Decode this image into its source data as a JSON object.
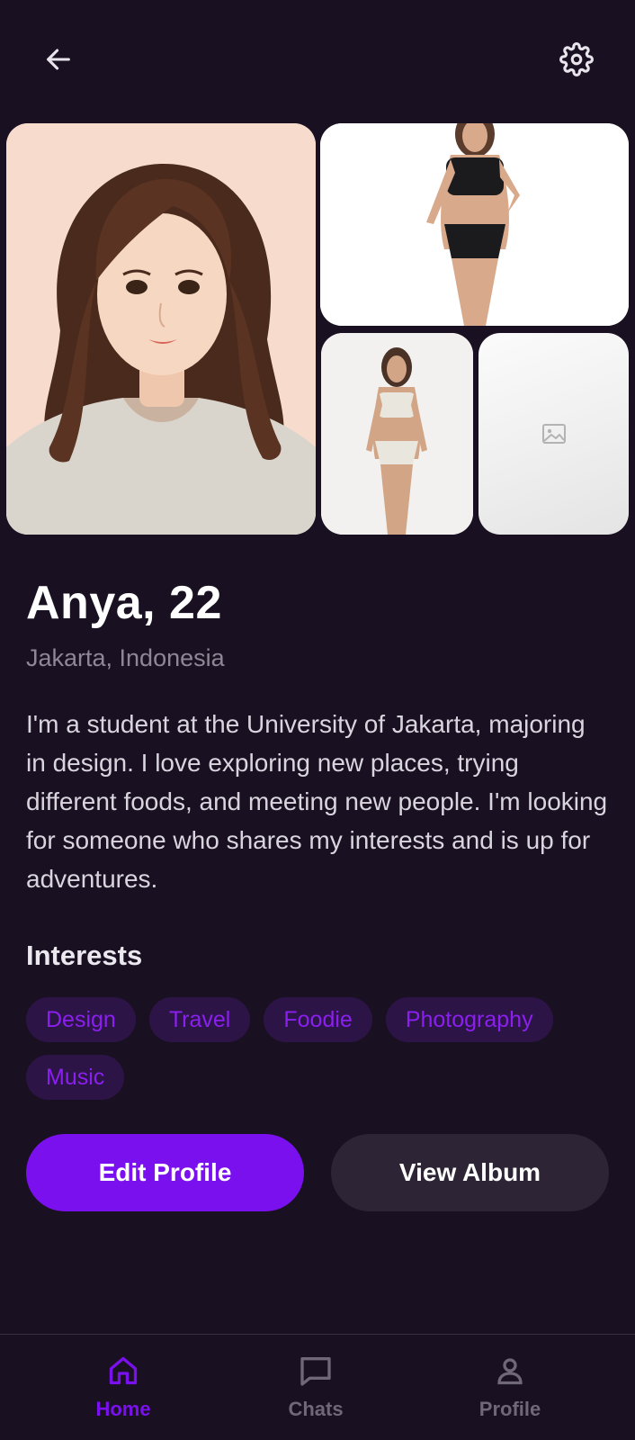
{
  "header": {
    "back_icon": "arrow-left-icon",
    "settings_icon": "gear-icon"
  },
  "photos": {
    "main": "portrait-illustration",
    "top_right": "photo",
    "small": "photo",
    "empty_icon": "image-placeholder-icon"
  },
  "profile": {
    "name_age": "Anya, 22",
    "location": "Jakarta, Indonesia",
    "bio": "I'm a student at the University of Jakarta, majoring in design. I love exploring new places, trying different foods, and meeting new people. I'm looking for someone who shares my interests and is up for adventures."
  },
  "interests": {
    "title": "Interests",
    "chips": [
      "Design",
      "Travel",
      "Foodie",
      "Photography",
      "Music"
    ]
  },
  "actions": {
    "edit_label": "Edit Profile",
    "album_label": "View Album"
  },
  "nav": {
    "items": [
      {
        "label": "Home",
        "icon": "home-icon",
        "active": true
      },
      {
        "label": "Chats",
        "icon": "chat-bubble-icon",
        "active": false
      },
      {
        "label": "Profile",
        "icon": "person-icon",
        "active": false
      }
    ]
  },
  "colors": {
    "background": "#191021",
    "accent": "#7a10ee",
    "chip_bg": "#2d1446",
    "secondary_button": "#2d2535",
    "muted_text": "#8e8896"
  }
}
